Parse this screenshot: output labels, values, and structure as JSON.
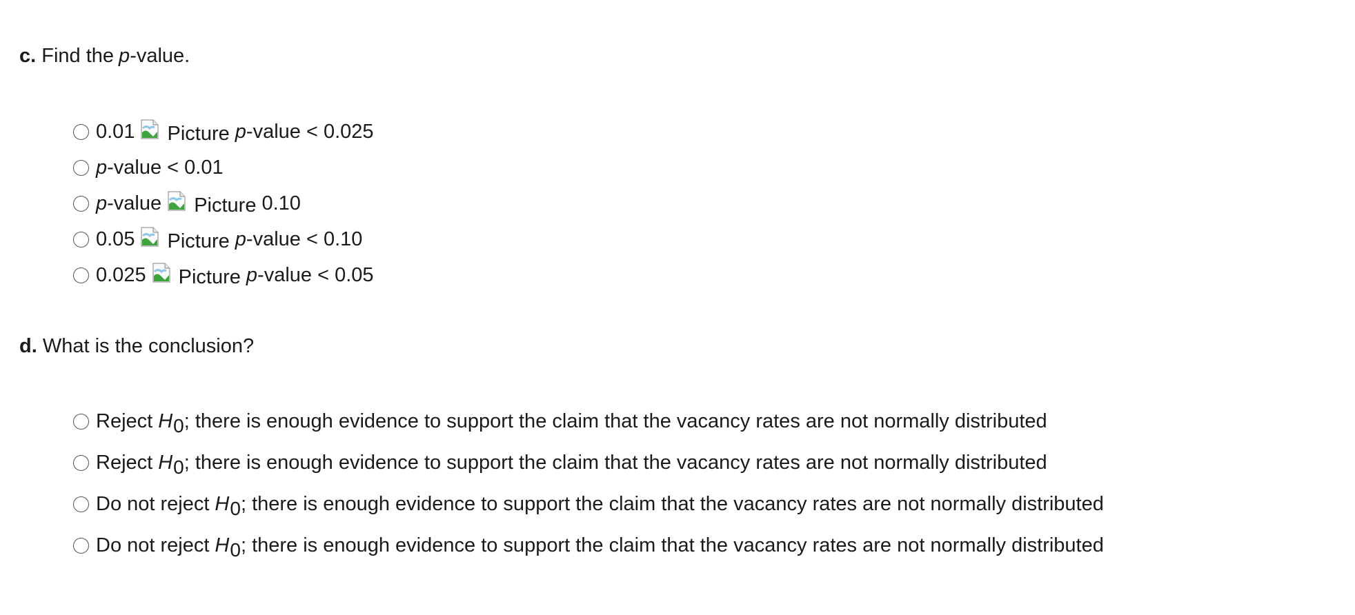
{
  "question_c": {
    "letter": "c.",
    "text_before": "Find the",
    "p": "p",
    "text_after": "-value."
  },
  "c_options": {
    "opt1": {
      "lower": "0.01",
      "pic_alt": "Picture",
      "p": "p",
      "rest": "-value < 0.025"
    },
    "opt2": {
      "p": "p",
      "rest": "-value < 0.01"
    },
    "opt3": {
      "p": "p",
      "mid": "-value",
      "pic_alt": "Picture",
      "value": "0.10"
    },
    "opt4": {
      "lower": "0.05",
      "pic_alt": "Picture",
      "p": "p",
      "rest": "-value < 0.10"
    },
    "opt5": {
      "lower": "0.025",
      "pic_alt": "Picture",
      "p": "p",
      "rest": "-value < 0.05"
    }
  },
  "question_d": {
    "letter": "d.",
    "text": "What is the conclusion?"
  },
  "d_options": {
    "opt1": {
      "prefix": "Reject",
      "h": "H",
      "sub": "0",
      "rest": "; there is enough evidence to support the claim that the vacancy rates are not normally distributed"
    },
    "opt2": {
      "prefix": "Reject",
      "h": "H",
      "sub": "0",
      "rest": "; there is enough evidence to support the claim that the vacancy rates are not normally distributed"
    },
    "opt3": {
      "prefix": "Do not reject",
      "h": "H",
      "sub": "0",
      "rest": "; there is enough evidence to support the claim that the vacancy rates are not normally distributed"
    },
    "opt4": {
      "prefix": "Do not reject",
      "h": "H",
      "sub": "0",
      "rest": "; there is enough evidence to support the claim that the vacancy rates are not normally distributed"
    }
  },
  "icons": {
    "radio": "radio-button-unchecked",
    "broken_image": "broken-image-icon"
  }
}
